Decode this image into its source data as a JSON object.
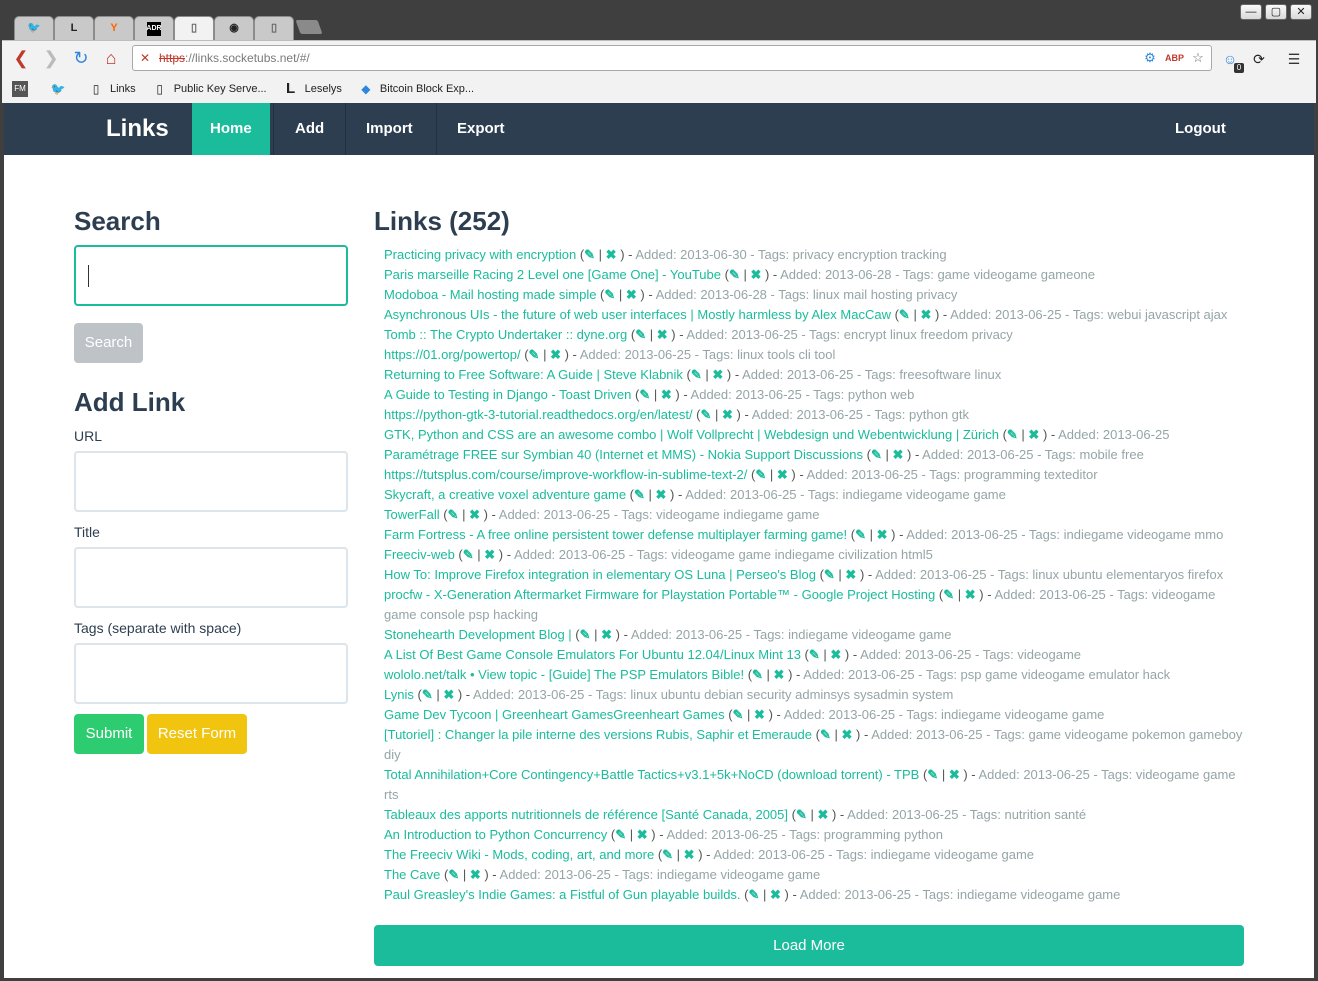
{
  "browser": {
    "tabs": [
      {
        "icon": "twitter-bird-icon",
        "glyph": "🐦",
        "color": "#1da1f2"
      },
      {
        "icon": "leselys-l-icon",
        "glyph": "L",
        "color": "#222"
      },
      {
        "icon": "ycombinator-y-icon",
        "glyph": "Y",
        "color": "#ff6600"
      },
      {
        "icon": "adr-icon",
        "glyph": "ADR",
        "color": "#000"
      },
      {
        "icon": "blank-page-icon",
        "glyph": "▯",
        "color": "#666"
      },
      {
        "icon": "github-octocat-icon",
        "glyph": "◉",
        "color": "#222"
      },
      {
        "icon": "blank-page-icon",
        "glyph": "▯",
        "color": "#666"
      }
    ],
    "url_protocol": "https",
    "url_rest": "://links.socketubs.net/#/",
    "bookmarks": [
      {
        "icon": "feedly-fm-icon",
        "glyph": "FM",
        "label": ""
      },
      {
        "icon": "twitter-bird-icon",
        "glyph": "🐦",
        "label": ""
      },
      {
        "icon": "page-icon",
        "glyph": "▯",
        "label": "Links"
      },
      {
        "icon": "page-icon",
        "glyph": "▯",
        "label": "Public Key Serve..."
      },
      {
        "icon": "leselys-l-icon",
        "glyph": "L",
        "label": "Leselys"
      },
      {
        "icon": "cube-icon",
        "glyph": "◆",
        "label": "Bitcoin Block Exp..."
      }
    ],
    "badge_count": "0"
  },
  "nav": {
    "brand": "Links",
    "items": [
      "Home",
      "Add",
      "Import",
      "Export"
    ],
    "logout": "Logout"
  },
  "sidebar": {
    "search_title": "Search",
    "search_button": "Search",
    "add_title": "Add Link",
    "url_label": "URL",
    "title_label": "Title",
    "tags_label": "Tags (separate with space)",
    "submit": "Submit",
    "reset": "Reset Form"
  },
  "links": {
    "title": "Links (252)",
    "load_more": "Load More",
    "items": [
      {
        "title": "Practicing privacy with encryption",
        "meta": "Added: 2013-06-30 - Tags: privacy encryption tracking"
      },
      {
        "title": "Paris marseille Racing 2 Level one [Game One] - YouTube",
        "meta": "Added: 2013-06-28 - Tags: game videogame gameone"
      },
      {
        "title": "Modoboa - Mail hosting made simple",
        "meta": "Added: 2013-06-28 - Tags: linux mail hosting privacy"
      },
      {
        "title": "Asynchronous UIs - the future of web user interfaces | Mostly harmless by Alex MacCaw",
        "meta": "Added: 2013-06-25 - Tags: webui javascript ajax"
      },
      {
        "title": "Tomb :: The Crypto Undertaker :: dyne.org",
        "meta": "Added: 2013-06-25 - Tags: encrypt linux freedom privacy"
      },
      {
        "title": "https://01.org/powertop/",
        "meta": "Added: 2013-06-25 - Tags: linux tools cli tool"
      },
      {
        "title": "Returning to Free Software: A Guide | Steve Klabnik",
        "meta": "Added: 2013-06-25 - Tags: freesoftware linux"
      },
      {
        "title": "A Guide to Testing in Django - Toast Driven",
        "meta": "Added: 2013-06-25 - Tags: python web"
      },
      {
        "title": "https://python-gtk-3-tutorial.readthedocs.org/en/latest/",
        "meta": "Added: 2013-06-25 - Tags: python gtk"
      },
      {
        "title": "GTK, Python and CSS are an awesome combo | Wolf Vollprecht | Webdesign und Webentwicklung | Zürich",
        "meta": "Added: 2013-06-25"
      },
      {
        "title": "Paramétrage FREE sur Symbian 40 (Internet et MMS) - Nokia Support Discussions",
        "meta": "Added: 2013-06-25 - Tags: mobile free"
      },
      {
        "title": "https://tutsplus.com/course/improve-workflow-in-sublime-text-2/",
        "meta": "Added: 2013-06-25 - Tags: programming texteditor"
      },
      {
        "title": "Skycraft, a creative voxel adventure game",
        "meta": "Added: 2013-06-25 - Tags: indiegame videogame game"
      },
      {
        "title": "TowerFall",
        "meta": "Added: 2013-06-25 - Tags: videogame indiegame game"
      },
      {
        "title": "Farm Fortress - A free online persistent tower defense multiplayer farming game!",
        "meta": "Added: 2013-06-25 - Tags: indiegame videogame mmo"
      },
      {
        "title": "Freeciv-web",
        "meta": "Added: 2013-06-25 - Tags: videogame game indiegame civilization html5"
      },
      {
        "title": "How To: Improve Firefox integration in elementary OS Luna | Perseo's Blog",
        "meta": "Added: 2013-06-25 - Tags: linux ubuntu elementaryos firefox"
      },
      {
        "title": "procfw - X-Generation Aftermarket Firmware for Playstation Portable™ - Google Project Hosting",
        "meta": "Added: 2013-06-25 - Tags: videogame game console psp hacking"
      },
      {
        "title": "Stonehearth Development Blog |",
        "meta": "Added: 2013-06-25 - Tags: indiegame videogame game"
      },
      {
        "title": "A List Of Best Game Console Emulators For Ubuntu 12.04/Linux Mint 13",
        "meta": "Added: 2013-06-25 - Tags: videogame"
      },
      {
        "title": "wololo.net/talk • View topic - [Guide] The PSP Emulators Bible!",
        "meta": "Added: 2013-06-25 - Tags: psp game videogame emulator hack"
      },
      {
        "title": "Lynis",
        "meta": "Added: 2013-06-25 - Tags: linux ubuntu debian security adminsys sysadmin system"
      },
      {
        "title": "Game Dev Tycoon | Greenheart GamesGreenheart Games",
        "meta": "Added: 2013-06-25 - Tags: indiegame videogame game"
      },
      {
        "title": "[Tutoriel] : Changer la pile interne des versions Rubis, Saphir et Emeraude",
        "meta": "Added: 2013-06-25 - Tags: game videogame pokemon gameboy diy"
      },
      {
        "title": "Total Annihilation+Core Contingency+Battle Tactics+v3.1+5k+NoCD (download torrent) - TPB",
        "meta": "Added: 2013-06-25 - Tags: videogame game rts"
      },
      {
        "title": "Tableaux des apports nutritionnels de référence [Santé Canada, 2005]",
        "meta": "Added: 2013-06-25 - Tags: nutrition santé"
      },
      {
        "title": "An Introduction to Python Concurrency",
        "meta": "Added: 2013-06-25 - Tags: programming python"
      },
      {
        "title": "The Freeciv Wiki - Mods, coding, art, and more",
        "meta": "Added: 2013-06-25 - Tags: indiegame videogame game"
      },
      {
        "title": "The Cave",
        "meta": "Added: 2013-06-25 - Tags: indiegame videogame game"
      },
      {
        "title": "Paul Greasley's Indie Games: a Fistful of Gun playable builds.",
        "meta": "Added: 2013-06-25 - Tags: indiegame videogame game"
      }
    ]
  },
  "colors": {
    "navbar": "#2c3e50",
    "accent": "#1abc9c",
    "warning": "#f1c40f",
    "success": "#2ecc71",
    "muted_button": "#bdc3c7"
  }
}
